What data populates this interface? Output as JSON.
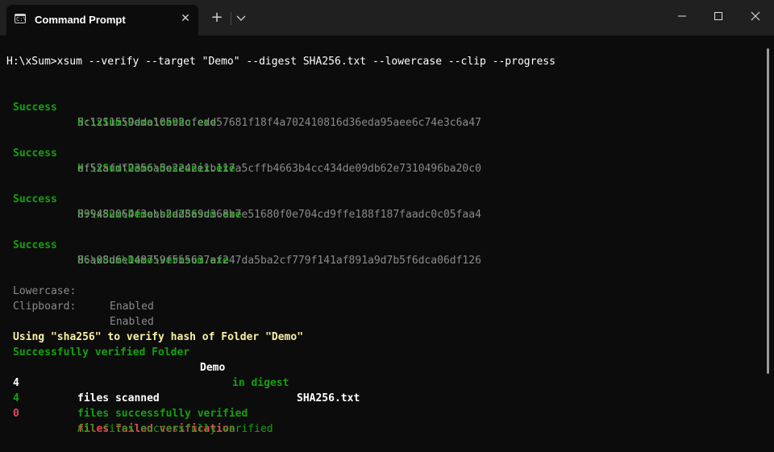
{
  "window": {
    "tab_title": "Command Prompt",
    "new_tab_symbol": "+",
    "close_tab_symbol": "✕"
  },
  "terminal": {
    "command_line": "H:\\xSum>xsum --verify --target \"Demo\" --digest SHA256.txt --lowercase --clip --progress",
    "entries": [
      {
        "status": "Success",
        "path": "H:\\xSum\\Demo\\cecho.exe",
        "hash": "5c1211559dda10592cfedd57681f18f4a702410816d36eda95aee6c74e3c6a47"
      },
      {
        "status": "Success",
        "path": "H:\\xSum\\Demo\\dos2unix.exe",
        "hash": "ef52afdf2356a5e2e42e1b117a5cffb4663b4cc434de09db62e7310496ba20c0"
      },
      {
        "status": "Success",
        "path": "H:\\xSum\\Demo\\sha256sum.exe",
        "hash": "899482064f3ebb2dd8a9d368b7e51680f0e704cd9ffe188f187faadc0c05faa4"
      },
      {
        "status": "Success",
        "path": "H:\\xSum\\Demo\\verisum.exe",
        "hash": "86a08d6e148759f5b5637af247da5ba2cf779f141af891a9d7b5f6dca06df126"
      }
    ],
    "settings": [
      {
        "label": "Lowercase:",
        "value": "Enabled"
      },
      {
        "label": "Clipboard:",
        "value": "Enabled"
      }
    ],
    "using_line": "Using \"sha256\" to verify hash of Folder \"Demo\"",
    "verified_line": {
      "part1": "Successfully verified Folder",
      "folder": "Demo",
      "part2": "in digest",
      "digest": "SHA256.txt"
    },
    "summary": [
      {
        "count": "4",
        "text": "files scanned"
      },
      {
        "count": "4",
        "text": "files successfully verified"
      },
      {
        "count": "0",
        "text": "files failed verification"
      }
    ],
    "final_message": "All files successfully verified"
  },
  "colors": {
    "background": "#0c0c0c",
    "titlebar": "#202020",
    "success_green": "#13a10e",
    "highlight_yellow": "#f9f1a5",
    "error_red": "#e74856",
    "dim_grey": "#8a8a8a"
  }
}
